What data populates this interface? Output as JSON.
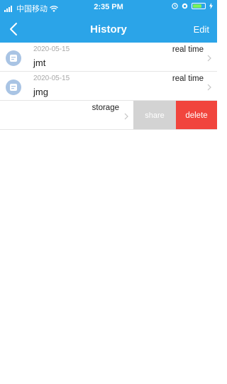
{
  "status_bar": {
    "carrier": "中国移动",
    "time": "2:35 PM",
    "battery_level": 0.75
  },
  "nav": {
    "title": "History",
    "edit_label": "Edit",
    "back_icon": "chevron-left-icon"
  },
  "records": [
    {
      "date": "2020-05-15",
      "name": "jmt",
      "type": "real time"
    },
    {
      "date": "2020-05-15",
      "name": "jmg",
      "type": "real time"
    }
  ],
  "swiped_row": {
    "type": "storage",
    "share_label": "share",
    "delete_label": "delete"
  },
  "colors": {
    "header": "#2ba4e8",
    "delete": "#f1453d",
    "share": "#d3d3d3",
    "avatar": "#a9c4e4"
  }
}
